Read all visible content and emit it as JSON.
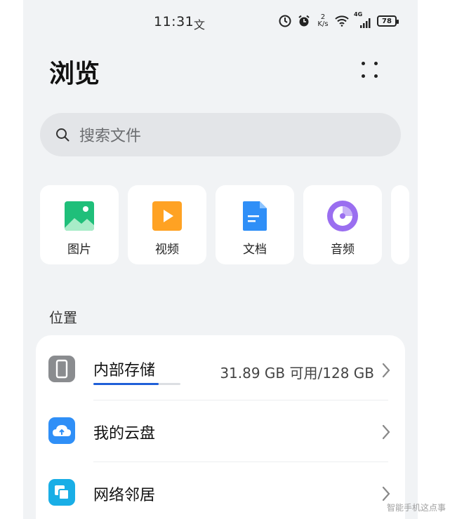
{
  "status_bar": {
    "time": "11:31",
    "time_glyph": "文",
    "net_speed_value": "2",
    "net_speed_unit": "K/s",
    "signal_type": "4G",
    "battery": "78"
  },
  "header": {
    "title": "浏览"
  },
  "search": {
    "placeholder": "搜索文件"
  },
  "categories": [
    {
      "label": "图片",
      "icon": "image-icon",
      "color": "#1fbf7a"
    },
    {
      "label": "视频",
      "icon": "video-icon",
      "color": "#ffa223"
    },
    {
      "label": "文档",
      "icon": "document-icon",
      "color": "#2f8ff7"
    },
    {
      "label": "音频",
      "icon": "audio-icon",
      "color": "#9a6ef0"
    }
  ],
  "locations_section": {
    "title": "位置",
    "items": [
      {
        "label": "内部存储",
        "detail": "31.89 GB 可用/128 GB",
        "icon": "phone-icon",
        "color": "#8a8c8f",
        "used_fraction": 0.75
      },
      {
        "label": "我的云盘",
        "detail": "",
        "icon": "cloud-icon",
        "color": "#2f8ff7"
      },
      {
        "label": "网络邻居",
        "detail": "",
        "icon": "network-icon",
        "color": "#19aee6"
      }
    ]
  },
  "watermark": "智能手机这点事"
}
